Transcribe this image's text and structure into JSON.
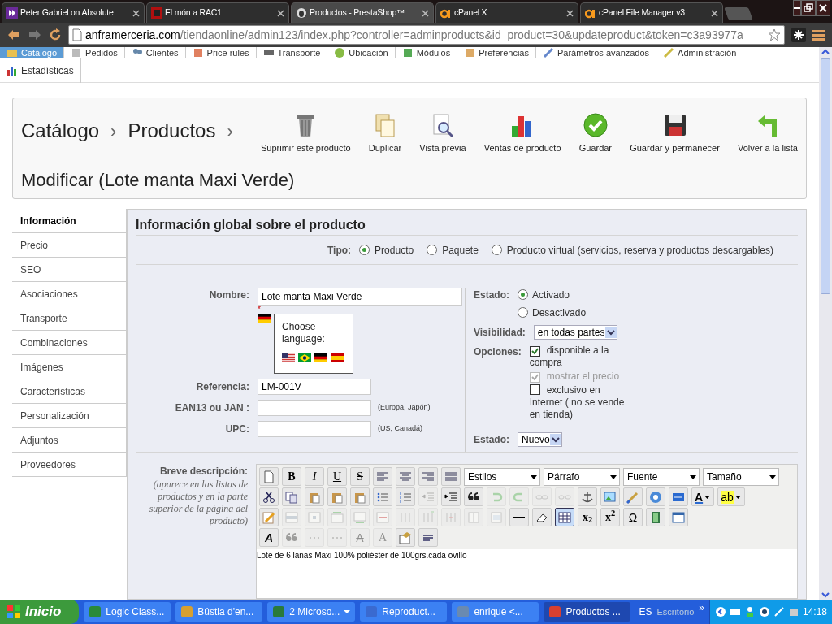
{
  "browser": {
    "tabs": [
      {
        "title": "Peter Gabriel on Absolute",
        "selected": false,
        "kind": "play"
      },
      {
        "title": "El món a RAC1",
        "selected": false,
        "kind": "rac"
      },
      {
        "title": "Productos - PrestaShop™",
        "selected": true,
        "kind": "shop"
      },
      {
        "title": "cPanel X",
        "selected": false,
        "kind": "cp"
      },
      {
        "title": "cPanel File Manager v3",
        "selected": false,
        "kind": "cp"
      }
    ],
    "url_host": "anframerceria.com",
    "url_path": "/tiendaonline/admin123/index.php?controller=adminproducts&id_product=30&updateproduct&token=c3a93977a"
  },
  "admin_menu": [
    {
      "label": "Catálogo",
      "selected": true
    },
    {
      "label": "Pedidos",
      "selected": false
    },
    {
      "label": "Clientes",
      "selected": false
    },
    {
      "label": "Price rules",
      "selected": false
    },
    {
      "label": "Transporte",
      "selected": false
    },
    {
      "label": "Ubicación",
      "selected": false
    },
    {
      "label": "Módulos",
      "selected": false
    },
    {
      "label": "Preferencias",
      "selected": false
    },
    {
      "label": "Parámetros avanzados",
      "selected": false
    },
    {
      "label": "Administración",
      "selected": false
    },
    {
      "label": "Estadísticas",
      "selected": false
    }
  ],
  "header": {
    "breadcrumb": [
      "Catálogo",
      "Productos"
    ],
    "separator": "›",
    "title": "Modificar (Lote manta Maxi Verde)",
    "actions": [
      {
        "label": "Suprimir este producto",
        "kind": "trash"
      },
      {
        "label": "Duplicar",
        "kind": "duplicate"
      },
      {
        "label": "Vista previa",
        "kind": "preview"
      },
      {
        "label": "Ventas de producto",
        "kind": "chart"
      },
      {
        "label": "Guardar",
        "kind": "check"
      },
      {
        "label": "Guardar y permanecer",
        "kind": "disk"
      },
      {
        "label": "Volver a la lista",
        "kind": "back"
      }
    ]
  },
  "sidebar": [
    {
      "label": "Información",
      "selected": true
    },
    {
      "label": "Precio",
      "selected": false
    },
    {
      "label": "SEO",
      "selected": false
    },
    {
      "label": "Asociaciones",
      "selected": false
    },
    {
      "label": "Transporte",
      "selected": false
    },
    {
      "label": "Combinaciones",
      "selected": false
    },
    {
      "label": "Imágenes",
      "selected": false
    },
    {
      "label": "Características",
      "selected": false
    },
    {
      "label": "Personalización",
      "selected": false
    },
    {
      "label": "Adjuntos",
      "selected": false
    },
    {
      "label": "Proveedores",
      "selected": false
    }
  ],
  "panel": {
    "title": "Información global sobre el producto",
    "tipo": {
      "label": "Tipo:",
      "options": [
        {
          "label": "Producto",
          "selected": true
        },
        {
          "label": "Paquete",
          "selected": false
        },
        {
          "label": "Producto virtual (servicios, reserva y productos descargables)",
          "selected": false
        }
      ]
    },
    "name": {
      "label": "Nombre:",
      "value": "Lote manta Maxi Verde",
      "required": "*"
    },
    "language_popup": {
      "title": "Choose language:"
    },
    "reference": {
      "label": "Referencia:",
      "value": "LM-001V"
    },
    "ean13": {
      "label": "EAN13 ou JAN :",
      "hint": "(Europa, Japón)"
    },
    "upc": {
      "label": "UPC:",
      "hint": "(US, Canadá)"
    },
    "status": {
      "label": "Estado:",
      "options": [
        {
          "label": "Activado",
          "selected": true
        },
        {
          "label": "Desactivado",
          "selected": false
        }
      ]
    },
    "visibility": {
      "label": "Visibilidad:",
      "value": "en todas partes"
    },
    "options": {
      "label": "Opciones:",
      "items": [
        {
          "label": "disponible a la compra",
          "checked": true,
          "disabled": false
        },
        {
          "label": "mostrar el precio",
          "checked": true,
          "disabled": true
        },
        {
          "label": "exclusivo en Internet ( no se vende en tienda)",
          "checked": false,
          "disabled": false
        }
      ]
    },
    "condition": {
      "label": "Estado:",
      "value": "Nuevo"
    },
    "short_description": {
      "label": "Breve descripción:",
      "hint": "(aparece en las listas de productos y en la parte superior de la página del producto)",
      "content": "Lote de 6 lanas Maxi 100% poliéster de 100grs.cada ovillo",
      "toolbar_rows": [
        [
          {
            "kind": "icon",
            "disabled": false,
            "active": false
          },
          {
            "kind": "glyph",
            "glyph": "B",
            "disabled": false,
            "active": false
          },
          {
            "kind": "glyph",
            "glyph": "I",
            "disabled": false,
            "active": false
          },
          {
            "kind": "glyph",
            "glyph": "U",
            "disabled": false,
            "active": false
          },
          {
            "kind": "glyph",
            "glyph": "S",
            "disabled": false,
            "active": false
          },
          {
            "kind": "icon",
            "disabled": false,
            "active": false
          },
          {
            "kind": "icon",
            "disabled": false,
            "active": false
          },
          {
            "kind": "icon",
            "disabled": false,
            "active": false
          },
          {
            "kind": "icon",
            "disabled": false,
            "active": false
          },
          {
            "kind": "select",
            "label": "Estilos"
          },
          {
            "kind": "select",
            "label": "Párrafo"
          },
          {
            "kind": "select",
            "label": "Fuente"
          },
          {
            "kind": "select",
            "label": "Tamaño"
          }
        ],
        [
          {
            "kind": "icon",
            "disabled": false,
            "active": false
          },
          {
            "kind": "icon",
            "disabled": false,
            "active": false
          },
          {
            "kind": "icon",
            "disabled": false,
            "active": false
          },
          {
            "kind": "icon",
            "disabled": false,
            "active": false
          },
          {
            "kind": "icon",
            "disabled": false,
            "active": false
          },
          {
            "kind": "icon",
            "disabled": false,
            "active": false
          },
          {
            "kind": "icon",
            "disabled": false,
            "active": false
          },
          {
            "kind": "icon",
            "disabled": true,
            "active": false
          },
          {
            "kind": "icon",
            "disabled": false,
            "active": false
          },
          {
            "kind": "icon",
            "disabled": false,
            "active": false
          },
          {
            "kind": "icon",
            "disabled": true,
            "active": false
          },
          {
            "kind": "icon",
            "disabled": true,
            "active": false
          },
          {
            "kind": "icon",
            "disabled": true,
            "active": false
          },
          {
            "kind": "icon",
            "disabled": true,
            "active": false
          },
          {
            "kind": "icon",
            "disabled": false,
            "active": false
          },
          {
            "kind": "icon",
            "disabled": false,
            "active": false
          },
          {
            "kind": "icon",
            "disabled": false,
            "active": false
          },
          {
            "kind": "icon",
            "disabled": false,
            "active": false
          },
          {
            "kind": "icon",
            "disabled": false,
            "active": false
          },
          {
            "kind": "split",
            "glyph": "A",
            "disabled": false,
            "active": false
          },
          {
            "kind": "split",
            "glyph": "ab",
            "disabled": false,
            "active": false
          }
        ],
        [
          {
            "kind": "icon",
            "disabled": false,
            "active": false
          },
          {
            "kind": "icon",
            "disabled": true,
            "active": false
          },
          {
            "kind": "icon",
            "disabled": true,
            "active": false
          },
          {
            "kind": "icon",
            "disabled": true,
            "active": false
          },
          {
            "kind": "icon",
            "disabled": true,
            "active": false
          },
          {
            "kind": "icon",
            "disabled": true,
            "active": false
          },
          {
            "kind": "icon",
            "disabled": true,
            "active": false
          },
          {
            "kind": "icon",
            "disabled": true,
            "active": false
          },
          {
            "kind": "icon",
            "disabled": true,
            "active": false
          },
          {
            "kind": "icon",
            "disabled": true,
            "active": false
          },
          {
            "kind": "icon",
            "disabled": true,
            "active": false
          },
          {
            "kind": "icon",
            "disabled": false,
            "active": false
          },
          {
            "kind": "icon",
            "disabled": false,
            "active": false
          },
          {
            "kind": "icon",
            "disabled": false,
            "active": true
          },
          {
            "kind": "glyph",
            "glyph": "x$_{2}$",
            "disabled": false,
            "active": false
          },
          {
            "kind": "glyph",
            "glyph": "x$^{2}$",
            "disabled": false,
            "active": false
          },
          {
            "kind": "glyph",
            "glyph": "Ω",
            "disabled": false,
            "active": false
          },
          {
            "kind": "icon",
            "disabled": false,
            "active": false
          },
          {
            "kind": "icon",
            "disabled": false,
            "active": false
          }
        ],
        [
          {
            "kind": "glyph",
            "glyph": "A",
            "disabled": false,
            "active": false
          },
          {
            "kind": "icon",
            "disabled": true,
            "active": false
          },
          {
            "kind": "icon",
            "disabled": true,
            "active": false
          },
          {
            "kind": "icon",
            "disabled": true,
            "active": false
          },
          {
            "kind": "glyph",
            "glyph": "A",
            "disabled": true,
            "active": false
          },
          {
            "kind": "glyph",
            "glyph": "A",
            "disabled": true,
            "active": false
          },
          {
            "kind": "icon",
            "disabled": false,
            "active": false
          },
          {
            "kind": "icon",
            "disabled": false,
            "active": false
          }
        ]
      ]
    }
  },
  "taskbar": {
    "start": "Inicio",
    "items": [
      {
        "label": "Logic Class...",
        "selected": false,
        "menu": false
      },
      {
        "label": "Bústia d'en...",
        "selected": false,
        "menu": false
      },
      {
        "label": "2 Microso...",
        "selected": false,
        "menu": true
      },
      {
        "label": "Reproduct...",
        "selected": false,
        "menu": false
      },
      {
        "label": "enrique <...",
        "selected": false,
        "menu": false
      },
      {
        "label": "Productos ...",
        "selected": true,
        "menu": false
      }
    ],
    "language": "ES",
    "desktop": "Escritorio",
    "more": "»",
    "clock": "14:18"
  }
}
